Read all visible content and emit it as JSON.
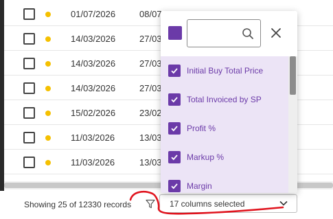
{
  "table": {
    "rows": [
      {
        "date1": "01/07/2026",
        "date2": "08/07"
      },
      {
        "date1": "14/03/2026",
        "date2": "27/03"
      },
      {
        "date1": "14/03/2026",
        "date2": "27/03"
      },
      {
        "date1": "14/03/2026",
        "date2": "27/03"
      },
      {
        "date1": "15/02/2026",
        "date2": "23/02"
      },
      {
        "date1": "11/03/2026",
        "date2": "13/03"
      },
      {
        "date1": "11/03/2026",
        "date2": "13/03"
      }
    ],
    "status_color": "#f5c000"
  },
  "footer": {
    "records_text": "Showing 25 of 12330 records",
    "columns_selected": "17 columns selected",
    "filter_icon": "funnel-icon",
    "dropdown_icon": "chevron-down-icon"
  },
  "column_picker": {
    "search_placeholder": "",
    "search_icon": "search-icon",
    "close_icon": "close-icon",
    "select_all_checked": true,
    "items": [
      {
        "label": "Initial Buy Total Price",
        "checked": true
      },
      {
        "label": "Total Invoiced by SP",
        "checked": true
      },
      {
        "label": "Profit %",
        "checked": true
      },
      {
        "label": "Markup %",
        "checked": true
      },
      {
        "label": "Margin",
        "checked": true
      }
    ],
    "accent_color": "#6b3aa8",
    "list_background": "#ece4f6"
  },
  "annotation": {
    "color": "#e0141e"
  }
}
